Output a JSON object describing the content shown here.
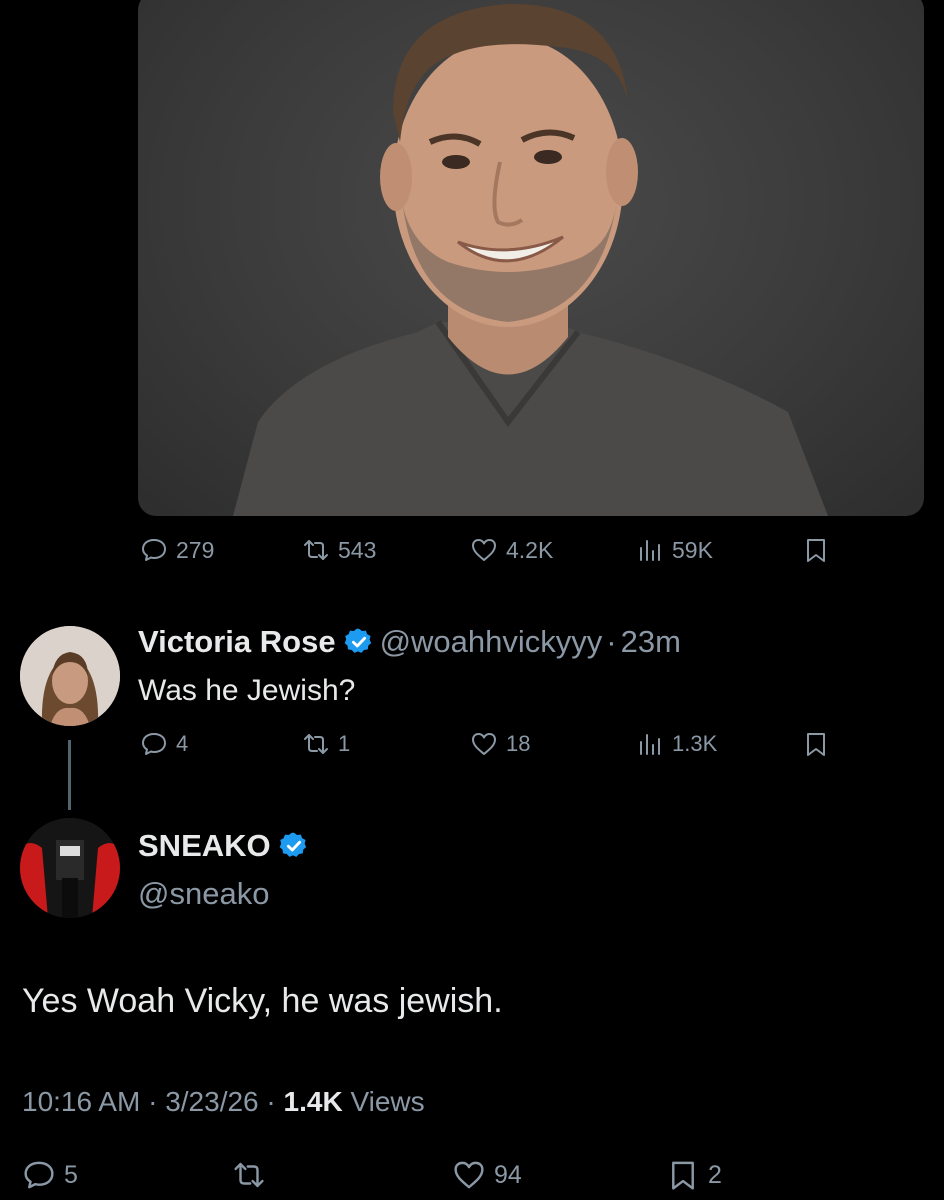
{
  "first_tweet": {
    "actions": {
      "replies": "279",
      "reposts": "543",
      "likes": "4.2K",
      "views": "59K"
    }
  },
  "reply": {
    "display_name": "Victoria Rose",
    "handle": "@woahhvickyyy",
    "separator": "·",
    "time": "23m",
    "text": "Was he Jewish?",
    "actions": {
      "replies": "4",
      "reposts": "1",
      "likes": "18",
      "views": "1.3K"
    }
  },
  "main_tweet": {
    "display_name": "SNEAKO",
    "handle": "@sneako",
    "text": "Yes Woah Vicky, he was jewish.",
    "time": "10:16 AM",
    "date": "3/23/26",
    "sep1": "·",
    "sep2": "·",
    "views_count": "1.4K",
    "views_label": "Views",
    "actions": {
      "replies": "5",
      "likes": "94",
      "bookmarks": "2"
    }
  },
  "colors": {
    "background": "#000000",
    "text": "#e7e9ea",
    "muted": "#8b98a5",
    "verified": "#1d9bf0"
  }
}
